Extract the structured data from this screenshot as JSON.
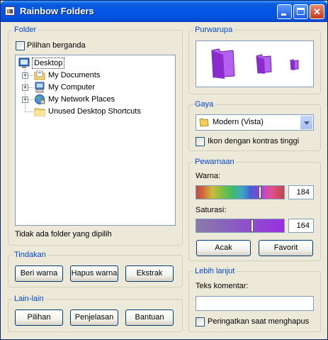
{
  "window": {
    "title": "Rainbow Folders"
  },
  "folder": {
    "legend": "Folder",
    "multi_select_label": "Pilihan berganda",
    "tree": [
      {
        "label": "Desktop"
      },
      {
        "label": "My Documents"
      },
      {
        "label": "My Computer"
      },
      {
        "label": "My Network Places"
      },
      {
        "label": "Unused Desktop Shortcuts"
      }
    ],
    "status": "Tidak ada folder yang dipilih"
  },
  "actions": {
    "legend": "Tindakan",
    "colorize": "Beri warna",
    "decolorize": "Hapus warna",
    "extract": "Ekstrak"
  },
  "misc": {
    "legend": "Lain-lain",
    "options": "Pilihan",
    "about": "Penjelasan",
    "help": "Bantuan"
  },
  "preview": {
    "legend": "Purwarupa",
    "folder_color": "#9b30d9"
  },
  "style": {
    "legend": "Gaya",
    "selected": "Modern (Vista)",
    "high_contrast_label": "Ikon dengan kontras tinggi"
  },
  "coloring": {
    "legend": "Pewarnaan",
    "hue_label": "Warna:",
    "hue_value": "184",
    "hue_fraction": 0.73,
    "saturation_label": "Saturasi:",
    "saturation_value": "164",
    "saturation_fraction": 0.64,
    "random": "Acak",
    "favorite": "Favorit"
  },
  "advanced": {
    "legend": "Lebih lanjut",
    "comment_label": "Teks komentar:",
    "comment_value": "",
    "warn_label": "Peringatkan saat menghapus"
  }
}
